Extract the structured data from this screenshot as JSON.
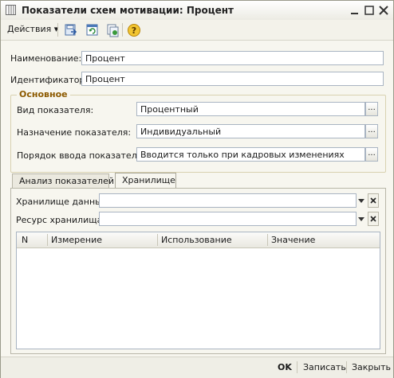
{
  "window": {
    "title": "Показатели схем мотивации: Процент"
  },
  "toolbar": {
    "actions_label": "Действия",
    "actions_arrow": "▾"
  },
  "form": {
    "name_label": "Наименование:",
    "name_value": "Процент",
    "id_label": "Идентификатор:",
    "id_value": "Процент"
  },
  "group": {
    "title": "Основное",
    "type_label": "Вид показателя:",
    "type_value": "Процентный",
    "purpose_label": "Назначение показателя:",
    "purpose_value": "Индивидуальный",
    "input_order_label": "Порядок ввода показателя:",
    "input_order_value": "Вводится только при кадровых изменениях",
    "dots": "..."
  },
  "tabs": [
    {
      "label": "Анализ показателей"
    },
    {
      "label": "Хранилище"
    }
  ],
  "storage": {
    "data_label": "Хранилище данных:",
    "data_value": "",
    "resource_label": "Ресурс хранилища:",
    "resource_value": ""
  },
  "grid": {
    "columns": [
      "N",
      "Измерение",
      "Использование",
      "Значение"
    ]
  },
  "footer": {
    "ok": "OK",
    "save": "Записать",
    "close": "Закрыть"
  },
  "colors": {
    "group_title": "#8c5a00",
    "field_border": "#a9b4c2"
  }
}
